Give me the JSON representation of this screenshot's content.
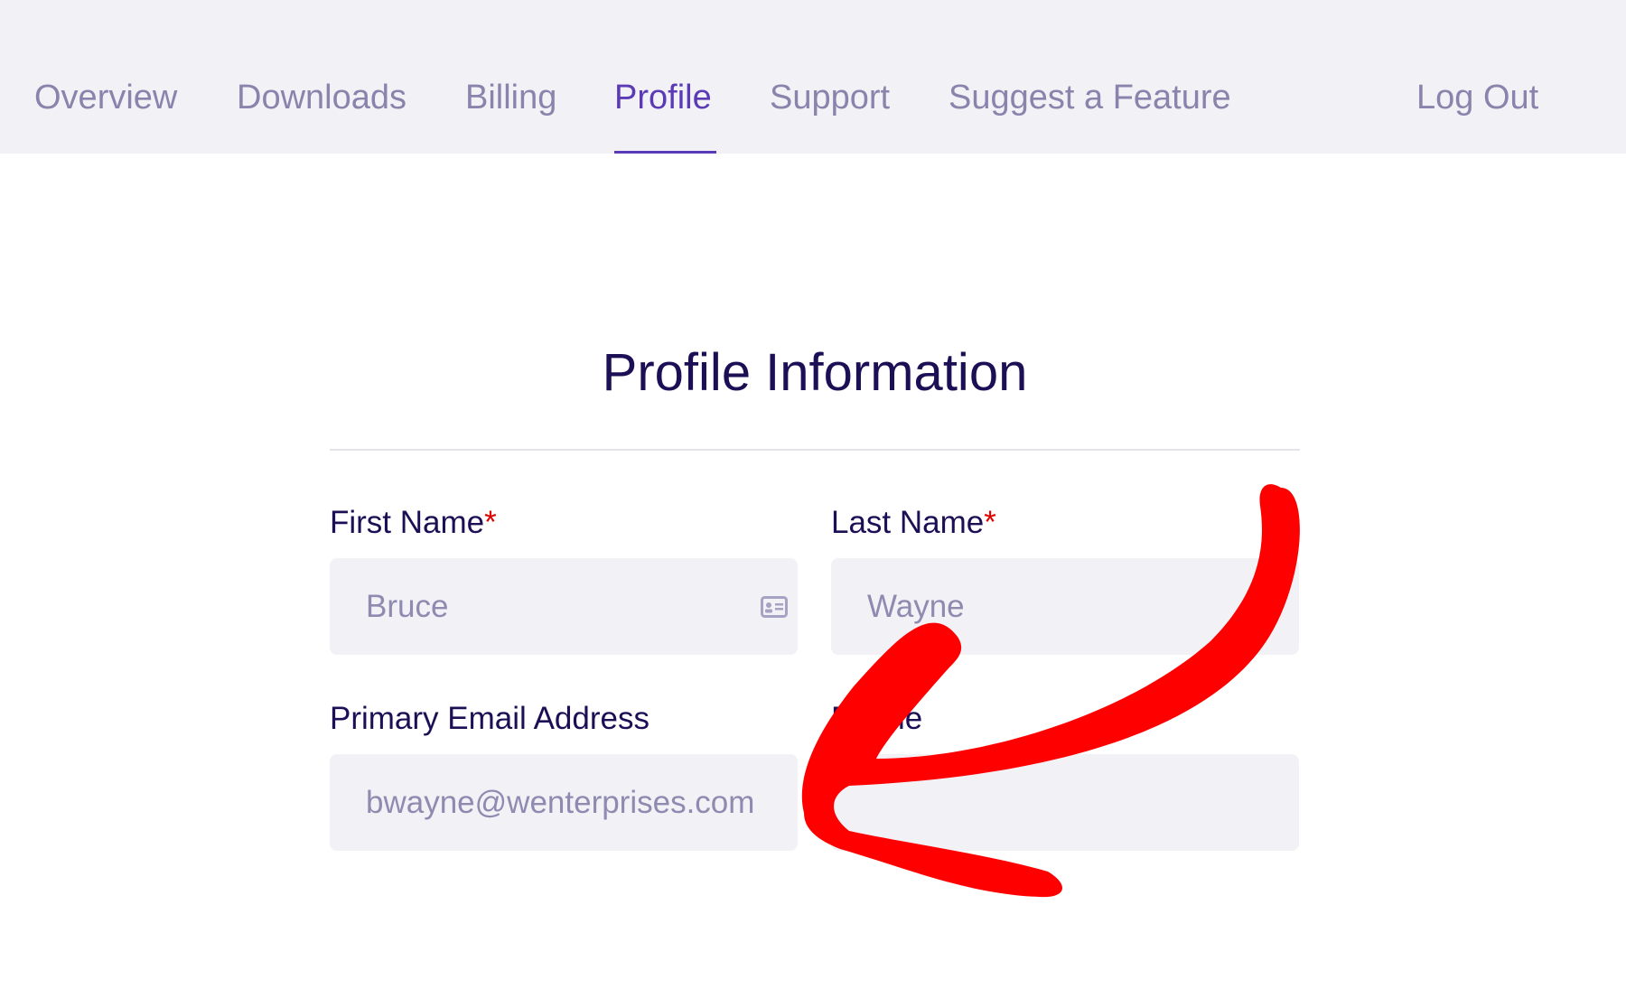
{
  "nav": {
    "items": [
      {
        "label": "Overview"
      },
      {
        "label": "Downloads"
      },
      {
        "label": "Billing"
      },
      {
        "label": "Profile"
      },
      {
        "label": "Support"
      },
      {
        "label": "Suggest a Feature"
      }
    ],
    "active": "Profile",
    "logout_label": "Log Out"
  },
  "form": {
    "title": "Profile Information",
    "first_name": {
      "label": "First Name",
      "required_mark": "*",
      "value": "Bruce",
      "icon": "contact-card-icon"
    },
    "last_name": {
      "label": "Last Name",
      "required_mark": "*",
      "value": "Wayne"
    },
    "email": {
      "label": "Primary Email Address",
      "value": "bwayne@wenterprises.com"
    },
    "phone": {
      "label": "Phone",
      "value": ""
    }
  },
  "annotation": {
    "icon": "red-arrow-annotation",
    "color": "#ff0000"
  },
  "colors": {
    "accent": "#5b3bb5",
    "nav_text": "#8a84ad",
    "heading_text": "#1d0f55",
    "input_bg": "#f2f1f6",
    "input_text": "#8f8ab0",
    "required": "#e00000"
  }
}
